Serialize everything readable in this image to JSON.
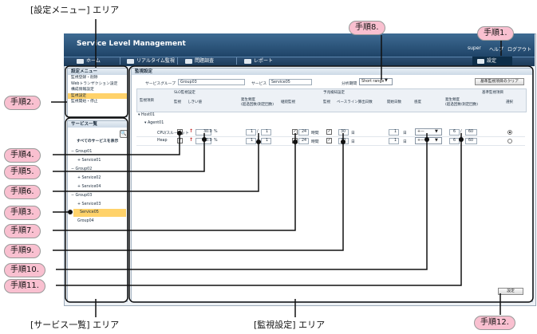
{
  "app": {
    "title": "Service Level Management",
    "user": "super",
    "help": "ヘルプ",
    "logout": "ログアウト",
    "nav": [
      "ホーム",
      "リアルタイム監視",
      "問題調査",
      "レポート",
      "設定"
    ]
  },
  "settings_menu": {
    "title": "設定メニュー",
    "items": [
      "監視登録・削除",
      "Webトランザクション設定",
      "構成情報設定",
      "監視設定",
      "監視開始・停止"
    ],
    "active_index": 3
  },
  "service_list": {
    "title": "サービス一覧",
    "all_label": "すべてのサービスを表示",
    "tree": [
      "Group01",
      "Service01",
      "Group02",
      "Service02",
      "Service04",
      "Group03",
      "Service03",
      "Service05",
      "Group04"
    ],
    "selected": "Service05"
  },
  "monitoring": {
    "title": "監視設定",
    "service_group_label": "サービスグループ",
    "service_group_value": "Group03",
    "service_label": "サービス",
    "service_value": "Service05",
    "period_label": "分析期間",
    "period_value": "Short range",
    "clear_button": "基準監視項目のクリア",
    "headers": {
      "item": "監視項目",
      "slo": "SLO監視設定",
      "watch": "監視",
      "threshold": "しきい値",
      "occurrence": "発生頻度",
      "occurrence_sub": "(超過回数/測定回数)",
      "continuous": "継続監視",
      "forecast": "予兆検知設定",
      "baseline": "ベースライン算出日数",
      "start_days": "開始日数",
      "sensitivity": "感度",
      "base_item": "基準監視項目",
      "select": "選択"
    },
    "tree": [
      "Host01",
      "Agent01"
    ],
    "rows": [
      {
        "name": "CPU/スループット",
        "threshold": "30.0",
        "unit": "%",
        "occ_a": "1",
        "occ_b": "1",
        "cont": "24",
        "cont_unit": "時間",
        "baseline": "30",
        "baseline_unit": "日",
        "start": "1",
        "start_unit": "日",
        "occ2_a": "6",
        "occ2_b": "60"
      },
      {
        "name": "Heap",
        "threshold": "30.0",
        "unit": "%",
        "occ_a": "1",
        "occ_b": "1",
        "cont": "24",
        "cont_unit": "時間",
        "baseline": "30",
        "baseline_unit": "日",
        "start": "1",
        "start_unit": "日",
        "occ2_a": "6",
        "occ2_b": "60"
      }
    ],
    "save_button": "設定"
  },
  "callouts": {
    "step1": "手順1.",
    "step2": "手順2.",
    "step3": "手順3.",
    "step4": "手順4.",
    "step5": "手順5.",
    "step6": "手順6.",
    "step7": "手順7.",
    "step8": "手順8.",
    "step9": "手順9.",
    "step10": "手順10.",
    "step11": "手順11.",
    "step12": "手順12."
  },
  "areas": {
    "settings_menu": "[設定メニュー] エリア",
    "service_list": "[サービス一覧] エリア",
    "monitoring": "[監視設定] エリア"
  }
}
